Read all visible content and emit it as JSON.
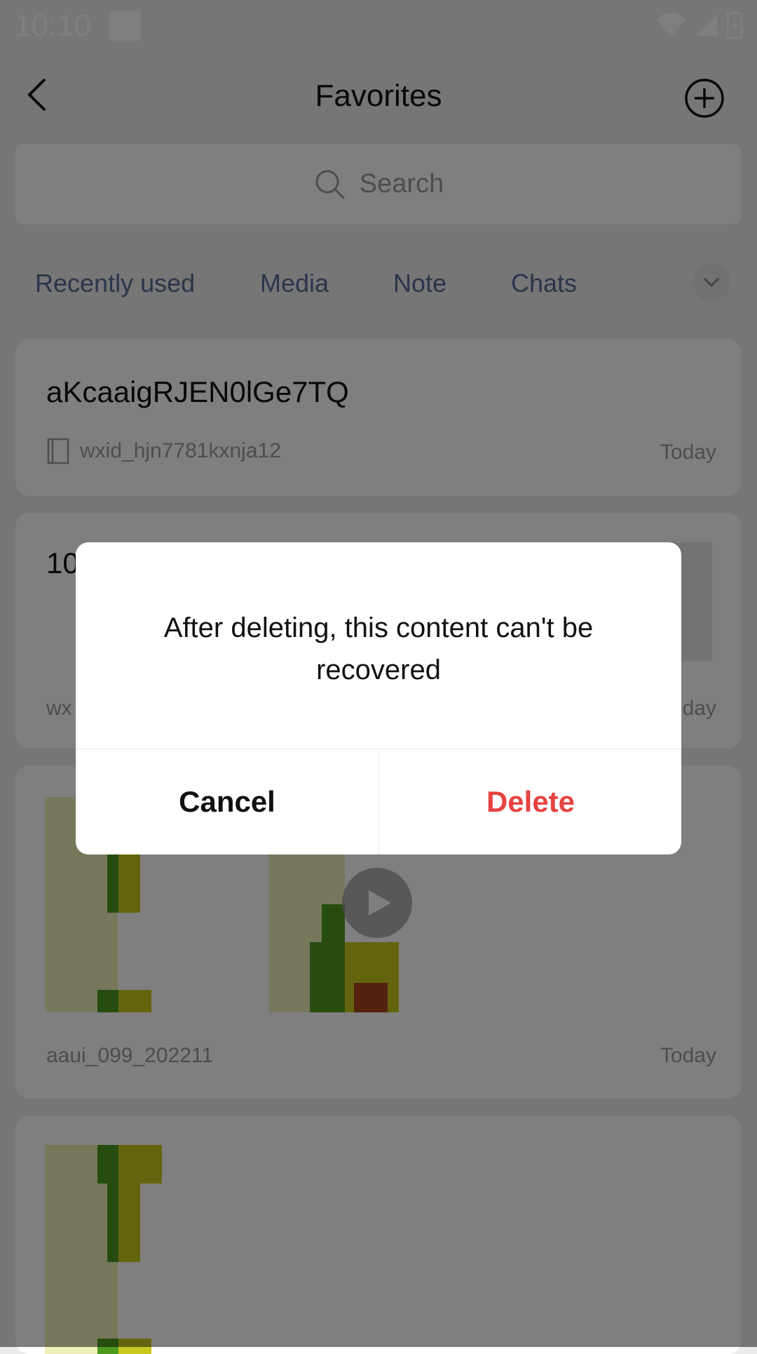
{
  "status_bar": {
    "time": "10:10"
  },
  "header": {
    "title": "Favorites"
  },
  "search": {
    "placeholder": "Search"
  },
  "tabs": [
    {
      "label": "Recently used"
    },
    {
      "label": "Media"
    },
    {
      "label": "Note"
    },
    {
      "label": "Chats"
    }
  ],
  "cards": [
    {
      "title": "aKcaaigRJEN0lGe7TQ",
      "source": "wxid_hjn7781kxnja12",
      "time": "Today"
    },
    {
      "title": "10",
      "source": "wx",
      "time": "day"
    },
    {
      "source": "aaui_099_202211",
      "time": "Today"
    }
  ],
  "dialog": {
    "message": "After deleting, this content can't be recovered",
    "cancel_label": "Cancel",
    "delete_label": "Delete"
  },
  "colors": {
    "accent_link": "#576b95",
    "danger": "#e64340",
    "overlay": "rgba(0,0,0,0.5)"
  }
}
